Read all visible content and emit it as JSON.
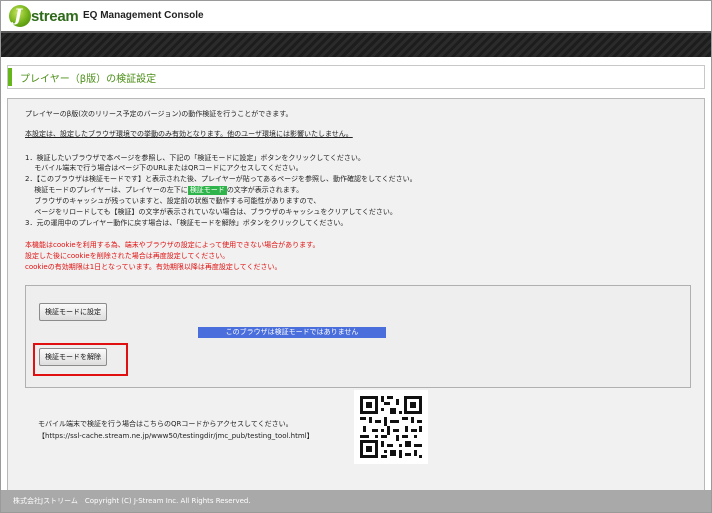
{
  "header": {
    "logo_text": "stream",
    "logo_mark": "J",
    "app_title": "EQ Management Console"
  },
  "page": {
    "title": "プレイヤー（β版）の検証設定"
  },
  "content": {
    "intro": "プレイヤーのβ版(次のリリース予定のバージョン)の動作検証を行うことができます。",
    "notice": "本設定は、設定したブラウザ環境での挙動のみ有効となります。他のユーザ環境には影響いたしません。",
    "steps": [
      "1．検証したいブラウザで本ページを参照し、下記の「検証モードに設定」ボタンをクリックしてください。",
      "　 モバイル端末で行う場合はページ下のURLまたはQRコードにアクセスしてください。",
      "2．【このブラウザは検証モードです】と表示された後、プレイヤーが貼ってあるページを参照し、動作確認をしてください。",
      "の文字が表示されます。",
      "　 ブラウザのキャッシュが残っていますと、設定前の状態で動作する可能性がありますので、",
      "　 ページをリロードしても【検証】の文字が表示されていない場合は、ブラウザのキャッシュをクリアしてください。",
      "3．元の運用中のプレイヤー動作に戻す場合は、「検証モードを解除」ボタンをクリックしてください。"
    ],
    "step2_sub_prefix": "　 検証モードのプレイヤーは、プレイヤーの左下に",
    "verify_badge": "検証モード",
    "warnings": [
      "本機能はcookieを利用する為、端末やブラウザの設定によって使用できない場合があります。",
      "設定した後にcookieを削除された場合は再度設定してください。",
      "cookieの有効期限は1日となっています。有効期限以降は再度設定してください。"
    ]
  },
  "panel": {
    "set_button": "検証モードに設定",
    "status_text": "このブラウザは検証モードではありません",
    "release_button": "検証モードを解除"
  },
  "mobile": {
    "text": "モバイル端末で検証を行う場合はこちらのQRコードからアクセスしてください。",
    "url": "【https://ssl-cache.stream.ne.jp/www50/testingdir/jmc_pub/testing_tool.html】"
  },
  "footer": {
    "copyright": "株式会社Jストリーム　Copyright (C) J-Stream Inc. All Rights Reserved."
  },
  "colors": {
    "brand_green": "#66b51b",
    "warning_red": "#e01010",
    "status_blue": "#4a6fdc",
    "badge_green": "#2eb44a"
  }
}
